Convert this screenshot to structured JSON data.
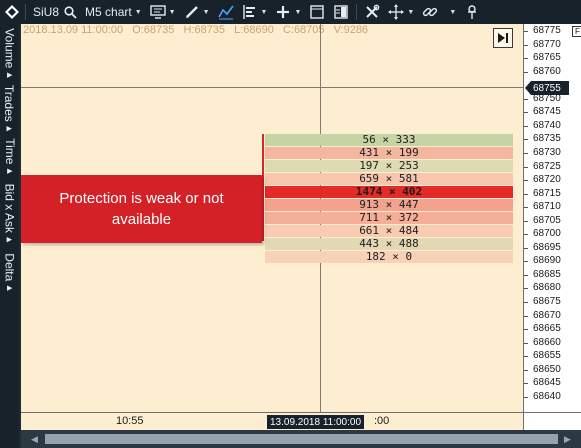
{
  "toolbar": {
    "symbol": "SiU8",
    "timeframe": "M5 chart"
  },
  "sidebar": {
    "tabs": [
      "Volume",
      "Trades",
      "Time",
      "Bid x Ask",
      "Delta"
    ]
  },
  "chart": {
    "ohlc": {
      "datetime": "2018.13.09 11:00:00",
      "open": "O:68735",
      "high": "H:68735",
      "low": "L:68690",
      "close": "C:68705",
      "volume": "V:9286"
    },
    "cluster": [
      {
        "text": "56 × 333",
        "color": "#c6d4a3"
      },
      {
        "text": "431 × 199",
        "color": "#f5b6a0"
      },
      {
        "text": "197 × 253",
        "color": "#dedbb3"
      },
      {
        "text": "659 × 581",
        "color": "#f7c6ad"
      },
      {
        "text": "1474 × 402",
        "color": "#e22b28",
        "poc": true
      },
      {
        "text": "913 × 447",
        "color": "#f4a18d"
      },
      {
        "text": "711 × 372",
        "color": "#f5ae98"
      },
      {
        "text": "661 × 484",
        "color": "#f8cbb2"
      },
      {
        "text": "443 × 488",
        "color": "#e2d8b3"
      },
      {
        "text": "182 × 0",
        "color": "#f9d1b6"
      }
    ],
    "protection_message": "Protection is weak or not available"
  },
  "price_axis": {
    "labels": [
      "68775",
      "68770",
      "68765",
      "68760",
      "68755",
      "68750",
      "68745",
      "68740",
      "68735",
      "68730",
      "68725",
      "68720",
      "68715",
      "68710",
      "68705",
      "68700",
      "68695",
      "68690",
      "68685",
      "68680",
      "68675",
      "68670",
      "68665",
      "68660",
      "68655",
      "68650",
      "68645",
      "68640"
    ],
    "current": "68755",
    "badge": "F"
  },
  "time_axis": {
    "label_left": "10:55",
    "current": "13.09.2018 11:00:00",
    "label_right": ":00"
  },
  "colors": {
    "chart_bg": "#feeed1",
    "frame": "#17222b",
    "alert_red": "#d42127"
  }
}
